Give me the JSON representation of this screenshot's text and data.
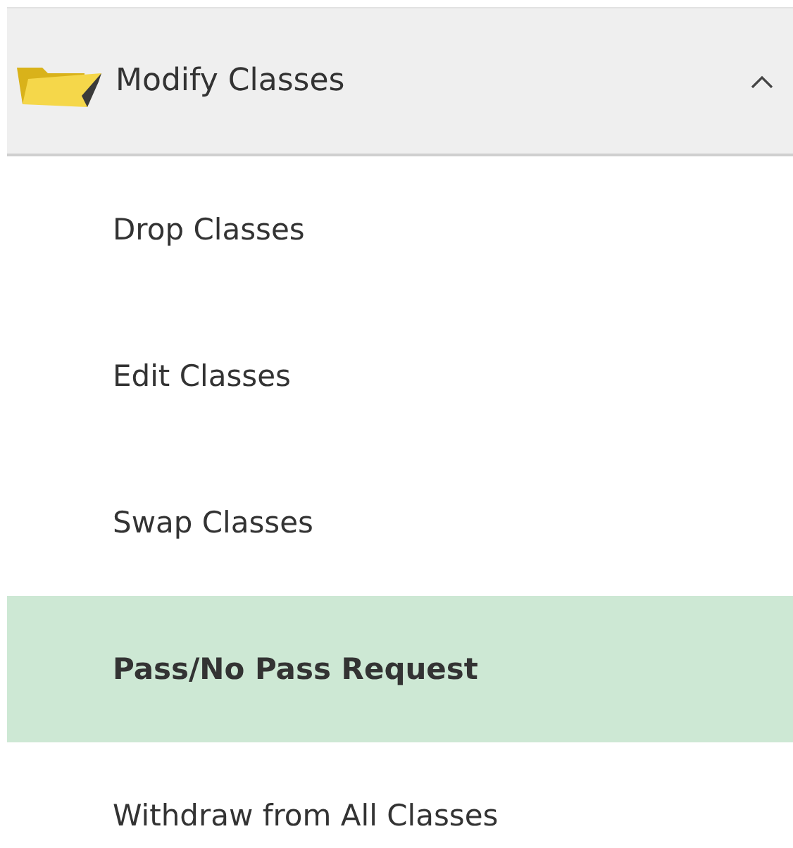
{
  "menu": {
    "title": "Modify Classes",
    "expanded": true,
    "items": [
      {
        "label": "Drop Classes",
        "selected": false
      },
      {
        "label": "Edit Classes",
        "selected": false
      },
      {
        "label": "Swap Classes",
        "selected": false
      },
      {
        "label": "Pass/No Pass Request",
        "selected": true
      },
      {
        "label": "Withdraw from All Classes",
        "selected": false
      }
    ]
  }
}
